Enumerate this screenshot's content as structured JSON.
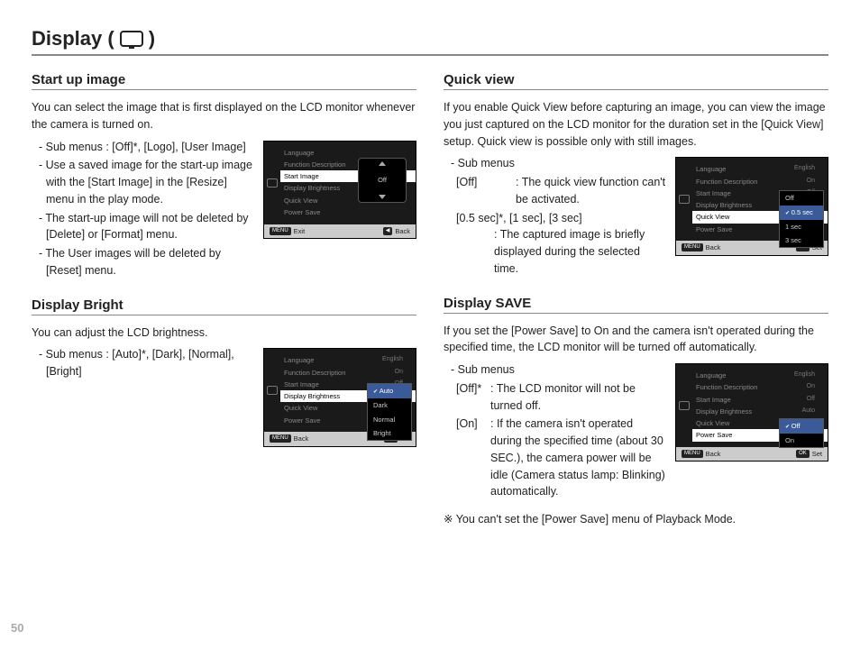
{
  "page": {
    "title_prefix": "Display (",
    "title_suffix": " )",
    "page_number": "50"
  },
  "startup": {
    "heading": "Start up image",
    "intro": "You can select the image that is first displayed on the LCD monitor whenever the camera is turned on.",
    "bullets": [
      "Sub menus : [Off]*, [Logo], [User Image]",
      "Use a saved image for the start-up image with the [Start Image] in the [Resize] menu in the play mode.",
      "The start-up image will not be deleted by [Delete] or [Format] menu.",
      "The User images will be deleted by [Reset] menu."
    ],
    "lcd": {
      "items": [
        "Language",
        "Function Description",
        "Start Image",
        "Display Brightness",
        "Quick View",
        "Power Save"
      ],
      "highlight": "Start Image",
      "popup_value": "Off",
      "footer_left": "Exit",
      "footer_left_btn": "MENU",
      "footer_right": "Back",
      "footer_right_icon": "◀"
    }
  },
  "bright": {
    "heading": "Display Bright",
    "intro": "You can adjust the LCD brightness.",
    "bullets": [
      "Sub menus : [Auto]*, [Dark], [Normal], [Bright]"
    ],
    "lcd": {
      "items": [
        {
          "label": "Language",
          "val": "English"
        },
        {
          "label": "Function Description",
          "val": "On"
        },
        {
          "label": "Start Image",
          "val": "Off"
        },
        {
          "label": "Display Brightness",
          "val": ""
        },
        {
          "label": "Quick View",
          "val": ""
        },
        {
          "label": "Power Save",
          "val": ""
        }
      ],
      "highlight": "Display Brightness",
      "popup": [
        "Auto",
        "Dark",
        "Normal",
        "Bright"
      ],
      "popup_sel": "Auto",
      "footer_left": "Back",
      "footer_left_btn": "MENU",
      "footer_right": "Set",
      "footer_right_btn": "OK"
    }
  },
  "quickview": {
    "heading": "Quick view",
    "intro": "If you enable Quick View before capturing an image, you can view the image you just captured on the LCD monitor for the duration set in the [Quick View] setup. Quick view is possible only with still images.",
    "sub_label": "Sub menus",
    "defs": [
      {
        "key": "[Off]",
        "desc": ": The quick view function can't be activated."
      },
      {
        "key": "[0.5 sec]*, [1 sec], [3 sec]",
        "desc": ": The captured image is briefly displayed during the selected time."
      }
    ],
    "lcd": {
      "items": [
        {
          "label": "Language",
          "val": "English"
        },
        {
          "label": "Function Description",
          "val": "On"
        },
        {
          "label": "Start Image",
          "val": "Off"
        },
        {
          "label": "Display Brightness",
          "val": ""
        },
        {
          "label": "Quick View",
          "val": ""
        },
        {
          "label": "Power Save",
          "val": ""
        }
      ],
      "highlight": "Quick View",
      "popup": [
        "Off",
        "0.5 sec",
        "1 sec",
        "3 sec"
      ],
      "popup_sel": "0.5 sec",
      "footer_left": "Back",
      "footer_left_btn": "MENU",
      "footer_right": "Set",
      "footer_right_btn": "OK"
    }
  },
  "save": {
    "heading": "Display SAVE",
    "intro": "If you set the [Power Save] to On and the camera isn't operated during the specified time, the LCD monitor will be turned off automatically.",
    "sub_label": "Sub menus",
    "defs": [
      {
        "key": "[Off]*",
        "desc": ": The LCD monitor will not be turned off."
      },
      {
        "key": "[On]",
        "desc": ": If the camera isn't operated during the specified time (about 30 SEC.), the camera power will be idle (Camera status lamp: Blinking) automatically."
      }
    ],
    "note": "※ You can't set the [Power Save] menu of Playback Mode.",
    "lcd": {
      "items": [
        {
          "label": "Language",
          "val": "English"
        },
        {
          "label": "Function Description",
          "val": "On"
        },
        {
          "label": "Start Image",
          "val": "Off"
        },
        {
          "label": "Display Brightness",
          "val": "Auto"
        },
        {
          "label": "Quick View",
          "val": ""
        },
        {
          "label": "Power Save",
          "val": ""
        }
      ],
      "highlight": "Power Save",
      "popup": [
        "Off",
        "On"
      ],
      "popup_sel": "Off",
      "footer_left": "Back",
      "footer_left_btn": "MENU",
      "footer_right": "Set",
      "footer_right_btn": "OK"
    }
  }
}
